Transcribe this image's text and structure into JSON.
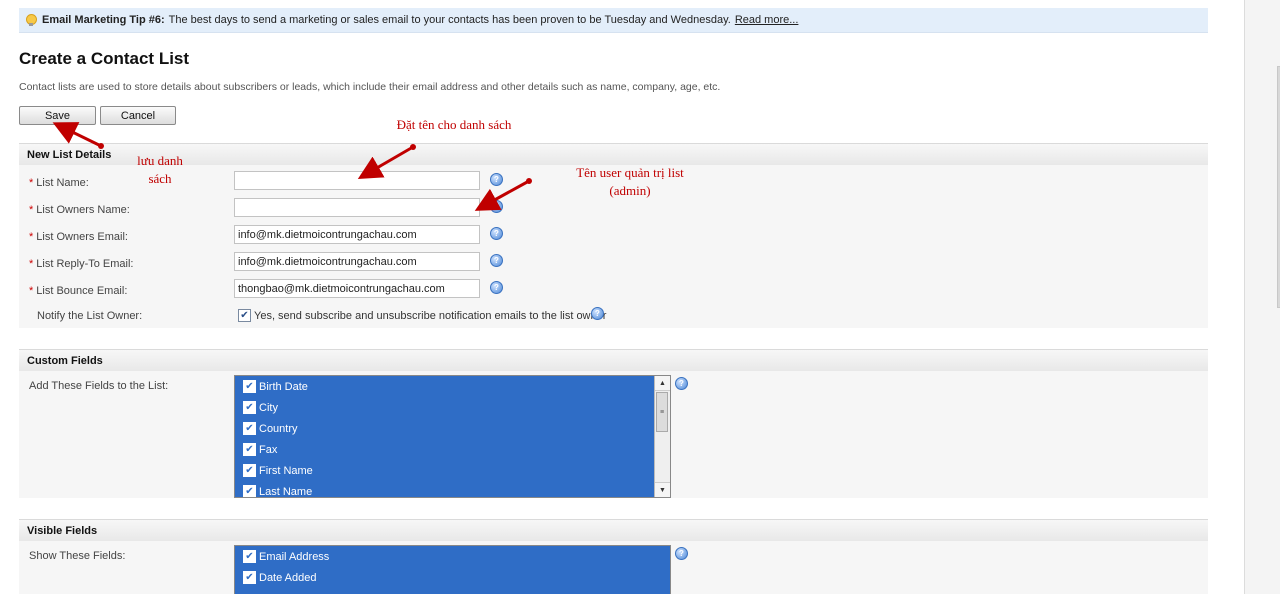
{
  "tip": {
    "title": "Email Marketing Tip #6:",
    "text": "The best days to send a marketing or sales email to your contacts has been proven to be Tuesday and Wednesday.",
    "link": "Read more..."
  },
  "page": {
    "title": "Create a Contact List",
    "description": "Contact lists are used to store details about subscribers or leads, which include their email address and other details such as name, company, age, etc."
  },
  "buttons": {
    "save": "Save",
    "cancel": "Cancel"
  },
  "new_list": {
    "header": "New List Details",
    "required_mark": "*",
    "fields": [
      {
        "label": "List Name:",
        "value": ""
      },
      {
        "label": "List Owners Name:",
        "value": ""
      },
      {
        "label": "List Owners Email:",
        "value": "info@mk.dietmoicontrungachau.com"
      },
      {
        "label": "List Reply-To Email:",
        "value": "info@mk.dietmoicontrungachau.com"
      },
      {
        "label": "List Bounce Email:",
        "value": "thongbao@mk.dietmoicontrungachau.com"
      }
    ],
    "notify": {
      "label": "Notify the List Owner:",
      "checkbox_label": "Yes, send subscribe and unsubscribe notification emails to the list owner",
      "checked": true
    }
  },
  "custom_fields": {
    "header": "Custom Fields",
    "label": "Add These Fields to the List:",
    "items": [
      "Birth Date",
      "City",
      "Country",
      "Fax",
      "First Name",
      "Last Name"
    ]
  },
  "visible_fields": {
    "header": "Visible Fields",
    "label": "Show These Fields:",
    "items": [
      "Email Address",
      "Date Added"
    ]
  },
  "annotations": {
    "save_note": [
      "lưu danh",
      "sách"
    ],
    "name_note": "Đặt tên cho danh sách",
    "owner_note": [
      "Tên user quản trị list",
      "(admin)"
    ]
  },
  "colors": {
    "list_selected": "#2f6dc6",
    "annotation": "#c00000",
    "tip_bg": "#e3eefa"
  }
}
